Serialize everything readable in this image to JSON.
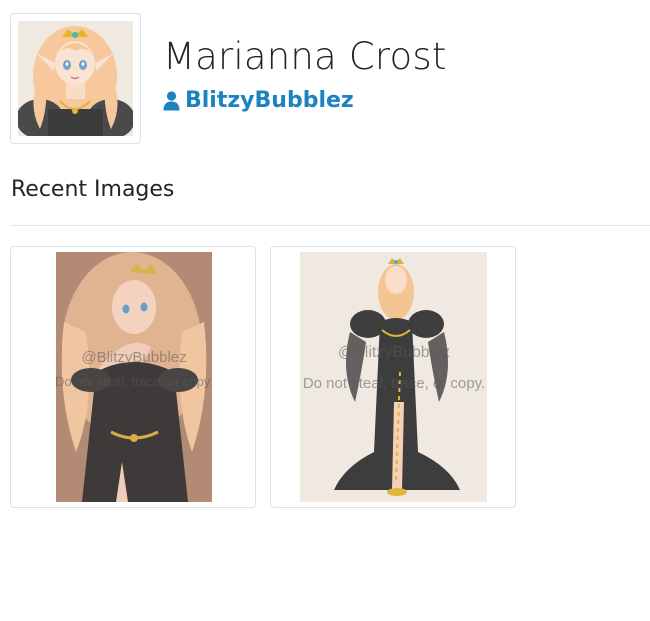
{
  "character": {
    "name": "Marianna Crost",
    "owner": "BlitzyBubblez"
  },
  "sections": {
    "recent_images_title": "Recent Images"
  },
  "images": [
    {
      "watermark_line1": "@BlitzyBubblez",
      "watermark_line2": "Do not steal, trace, or copy."
    },
    {
      "watermark_line1": "@BlitzyBubblez",
      "watermark_line2": "Do not steal, trace, or copy."
    }
  ],
  "colors": {
    "link": "#1b83c1",
    "text": "#212529",
    "border": "#dee2e6",
    "card1_bg": "#b38a74",
    "card2_bg": "#efe9e1",
    "avatar_bg": "#efe9e1"
  },
  "icons": {
    "owner": "user-icon"
  }
}
